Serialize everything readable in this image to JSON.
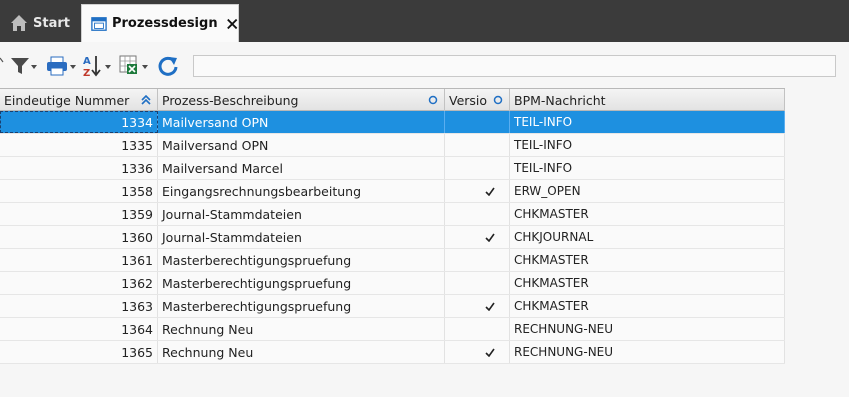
{
  "tabs": {
    "start_label": "Start",
    "active_label": "Prozessdesign"
  },
  "toolbar": {
    "search_value": ""
  },
  "grid": {
    "columns": [
      {
        "label": "Eindeutige Nummer"
      },
      {
        "label": "Prozess-Beschreibung"
      },
      {
        "label": "Versio"
      },
      {
        "label": "BPM-Nachricht"
      }
    ],
    "rows": [
      {
        "num": "1334",
        "desc": "Mailversand OPN",
        "version": false,
        "bpm": "TEIL-INFO",
        "selected": true
      },
      {
        "num": "1335",
        "desc": "Mailversand OPN",
        "version": false,
        "bpm": "TEIL-INFO"
      },
      {
        "num": "1336",
        "desc": "Mailversand Marcel",
        "version": false,
        "bpm": "TEIL-INFO"
      },
      {
        "num": "1358",
        "desc": "Eingangsrechnungsbearbeitung",
        "version": true,
        "bpm": "ERW_OPEN"
      },
      {
        "num": "1359",
        "desc": "Journal-Stammdateien",
        "version": false,
        "bpm": "CHKMASTER"
      },
      {
        "num": "1360",
        "desc": "Journal-Stammdateien",
        "version": true,
        "bpm": "CHKJOURNAL"
      },
      {
        "num": "1361",
        "desc": "Masterberechtigungspruefung",
        "version": false,
        "bpm": "CHKMASTER"
      },
      {
        "num": "1362",
        "desc": "Masterberechtigungspruefung",
        "version": false,
        "bpm": "CHKMASTER"
      },
      {
        "num": "1363",
        "desc": "Masterberechtigungspruefung",
        "version": true,
        "bpm": "CHKMASTER"
      },
      {
        "num": "1364",
        "desc": "Rechnung Neu",
        "version": false,
        "bpm": "RECHNUNG-NEU"
      },
      {
        "num": "1365",
        "desc": "Rechnung Neu",
        "version": true,
        "bpm": "RECHNUNG-NEU"
      }
    ]
  },
  "colors": {
    "tabbar": "#3b3b3b",
    "selected_row": "#1e90e0",
    "accent_icon": "#1f6fc4"
  }
}
